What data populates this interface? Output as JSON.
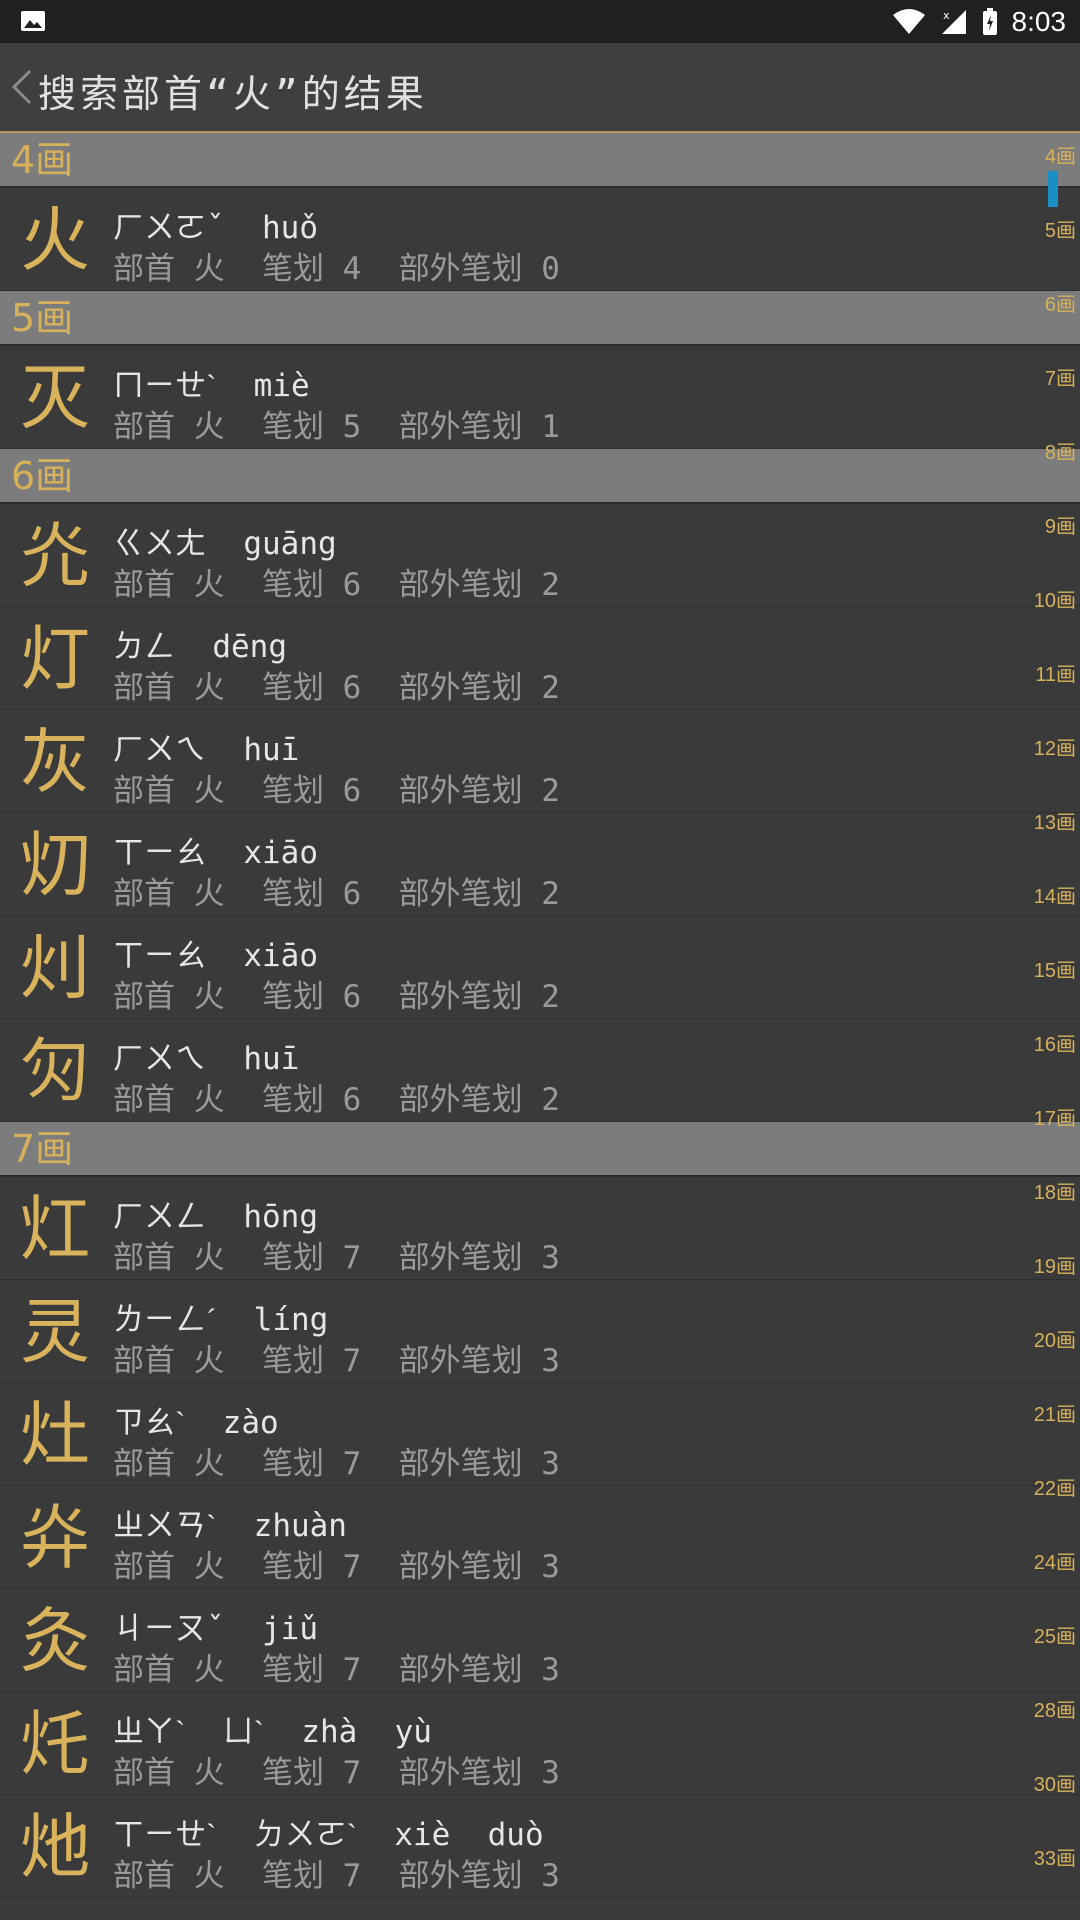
{
  "status": {
    "time": "8:03"
  },
  "header": {
    "title": "搜索部首“火”的结果"
  },
  "sections": [
    {
      "label": "4画",
      "items": [
        {
          "char": "火",
          "zhuyin": "ㄏㄨㄛˇ",
          "pinyin": "huǒ",
          "meta": "部首 火  笔划 4  部外笔划 0"
        }
      ]
    },
    {
      "label": "5画",
      "items": [
        {
          "char": "灭",
          "zhuyin": "ㄇㄧㄝˋ",
          "pinyin": "miè",
          "meta": "部首 火  笔划 5  部外笔划 1"
        }
      ]
    },
    {
      "label": "6画",
      "items": [
        {
          "char": "灮",
          "zhuyin": "ㄍㄨㄤ",
          "pinyin": "guāng",
          "meta": "部首 火  笔划 6  部外笔划 2"
        },
        {
          "char": "灯",
          "zhuyin": "ㄉㄥ",
          "pinyin": "dēng",
          "meta": "部首 火  笔划 6  部外笔划 2"
        },
        {
          "char": "灰",
          "zhuyin": "ㄏㄨㄟ",
          "pinyin": "huī",
          "meta": "部首 火  笔划 6  部外笔划 2"
        },
        {
          "char": "灱",
          "zhuyin": "ㄒㄧㄠ",
          "pinyin": "xiāo",
          "meta": "部首 火  笔划 6  部外笔划 2"
        },
        {
          "char": "灲",
          "zhuyin": "ㄒㄧㄠ",
          "pinyin": "xiāo",
          "meta": "部首 火  笔划 6  部外笔划 2"
        },
        {
          "char": "灳",
          "zhuyin": "ㄏㄨㄟ",
          "pinyin": "huī",
          "meta": "部首 火  笔划 6  部外笔划 2"
        }
      ]
    },
    {
      "label": "7画",
      "items": [
        {
          "char": "灴",
          "zhuyin": "ㄏㄨㄥ",
          "pinyin": "hōng",
          "meta": "部首 火  笔划 7  部外笔划 3"
        },
        {
          "char": "灵",
          "zhuyin": "ㄌㄧㄥˊ",
          "pinyin": "líng",
          "meta": "部首 火  笔划 7  部外笔划 3"
        },
        {
          "char": "灶",
          "zhuyin": "ㄗㄠˋ",
          "pinyin": "zào",
          "meta": "部首 火  笔划 7  部外笔划 3"
        },
        {
          "char": "灷",
          "zhuyin": "ㄓㄨㄢˋ",
          "pinyin": "zhuàn",
          "meta": "部首 火  笔划 7  部外笔划 3"
        },
        {
          "char": "灸",
          "zhuyin": "ㄐㄧㄡˇ",
          "pinyin": "jiǔ",
          "meta": "部首 火  笔划 7  部外笔划 3"
        },
        {
          "char": "灹",
          "zhuyin": "ㄓㄚˋ  ㄩˋ",
          "pinyin": "zhà  yù",
          "meta": "部首 火  笔划 7  部外笔划 3"
        },
        {
          "char": "灺",
          "zhuyin": "ㄒㄧㄝˋ  ㄉㄨㄛˋ",
          "pinyin": "xiè  duò",
          "meta": "部首 火  笔划 7  部外笔划 3"
        }
      ]
    }
  ],
  "index_bar": [
    "4画",
    "5画",
    "6画",
    "7画",
    "8画",
    "9画",
    "10画",
    "11画",
    "12画",
    "13画",
    "14画",
    "15画",
    "16画",
    "17画",
    "18画",
    "19画",
    "20画",
    "21画",
    "22画",
    "24画",
    "25画",
    "28画",
    "30画",
    "33画"
  ],
  "colors": {
    "accent": "#d6b15b",
    "scroll": "#1a8fc6",
    "section_bg": "#7c7c7c",
    "background": "#3a3a3b"
  }
}
